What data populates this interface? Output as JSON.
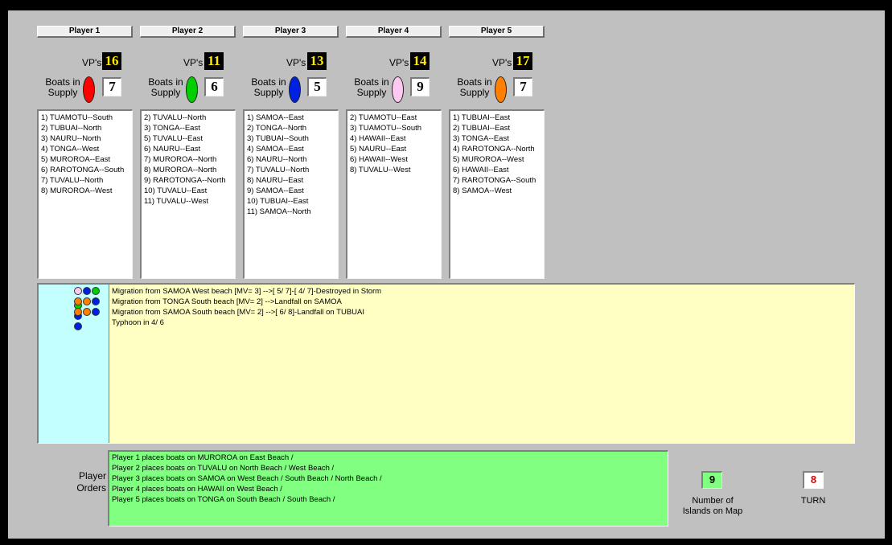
{
  "players": [
    {
      "name": "Player 1",
      "vp_label": "VP's",
      "vp": "16",
      "boats_label_1": "Boats in",
      "boats_label_2": "Supply",
      "color": "#ff0000",
      "boats": "7",
      "moves": [
        "1) TUAMOTU--South",
        "2) TUBUAI--North",
        "3) NAURU--North",
        "4) TONGA--West",
        "5) MUROROA--East",
        "6) RAROTONGA--South",
        "7) TUVALU--North",
        "8) MUROROA--West"
      ]
    },
    {
      "name": "Player 2",
      "vp_label": "VP's",
      "vp": "11",
      "boats_label_1": "Boats in",
      "boats_label_2": "Supply",
      "color": "#00d000",
      "boats": "6",
      "moves": [
        "2) TUVALU--North",
        "3) TONGA--East",
        "5) TUVALU--East",
        "6) NAURU--East",
        "7) MUROROA--North",
        "8) MUROROA--North",
        "9) RAROTONGA--North",
        "10) TUVALU--East",
        "11) TUVALU--West"
      ]
    },
    {
      "name": "Player 3",
      "vp_label": "VP's",
      "vp": "13",
      "boats_label_1": "Boats in",
      "boats_label_2": "Supply",
      "color": "#0020e0",
      "boats": "5",
      "moves": [
        "1) SAMOA--East",
        "2) TONGA--North",
        "3) TUBUAI--South",
        "4) SAMOA--East",
        "6) NAURU--North",
        "7) TUVALU--North",
        "8) NAURU--East",
        "9) SAMOA--East",
        "10) TUBUAI--East",
        "11) SAMOA--North"
      ]
    },
    {
      "name": "Player 4",
      "vp_label": "VP's",
      "vp": "14",
      "boats_label_1": "Boats in",
      "boats_label_2": "Supply",
      "color": "#ffc8f0",
      "boats": "9",
      "moves": [
        "2) TUAMOTU--East",
        "3) TUAMOTU--South",
        "4) HAWAII--East",
        "5) NAURU--East",
        "6) HAWAII--West",
        "8) TUVALU--West"
      ]
    },
    {
      "name": "Player 5",
      "vp_label": "VP's",
      "vp": "17",
      "boats_label_1": "Boats in",
      "boats_label_2": "Supply",
      "color": "#ff8000",
      "boats": "7",
      "moves": [
        "1) TUBUAI--East",
        "2) TUBUAI--East",
        "3) TONGA--East",
        "4) RAROTONGA--North",
        "5) MUROROA--West",
        "6) HAWAII--East",
        "7) RAROTONGA--South",
        "8) SAMOA--West"
      ]
    }
  ],
  "log": {
    "entries": [
      "Migration from SAMOA West beach [MV= 3] -->[ 5/ 7]-[ 4/ 7]-Destroyed in Storm",
      "Migration from TONGA South beach [MV= 2] -->Landfall on SAMOA",
      "Migration from SAMOA South beach [MV= 2] -->[ 6/ 8]-Landfall on TUBUAI",
      "Typhoon in  4/ 6"
    ],
    "dot_rows": [
      [
        "#ffc8f0",
        "#0020e0",
        "#00d000",
        "#00d000"
      ],
      [
        "#ff8000",
        "#ff8000",
        "#0020e0",
        "#0020e0"
      ],
      [
        "#ff8000",
        "#ff8000",
        "#0020e0",
        "#0020e0"
      ]
    ]
  },
  "orders": {
    "label_1": "Player",
    "label_2": "Orders",
    "lines": [
      "Player 1 places boats on MUROROA on  East Beach /",
      "Player 2 places boats on TUVALU on  North Beach /  West Beach /",
      "Player 3 places boats on SAMOA on  West Beach /  South Beach /  North Beach /",
      "Player 4 places boats on HAWAII on  West Beach /",
      "Player 5 places boats on TONGA on  South Beach /  South Beach /"
    ]
  },
  "islands": {
    "value": "9",
    "label_1": "Number of",
    "label_2": "Islands on Map"
  },
  "turn": {
    "value": "8",
    "label": "TURN"
  }
}
